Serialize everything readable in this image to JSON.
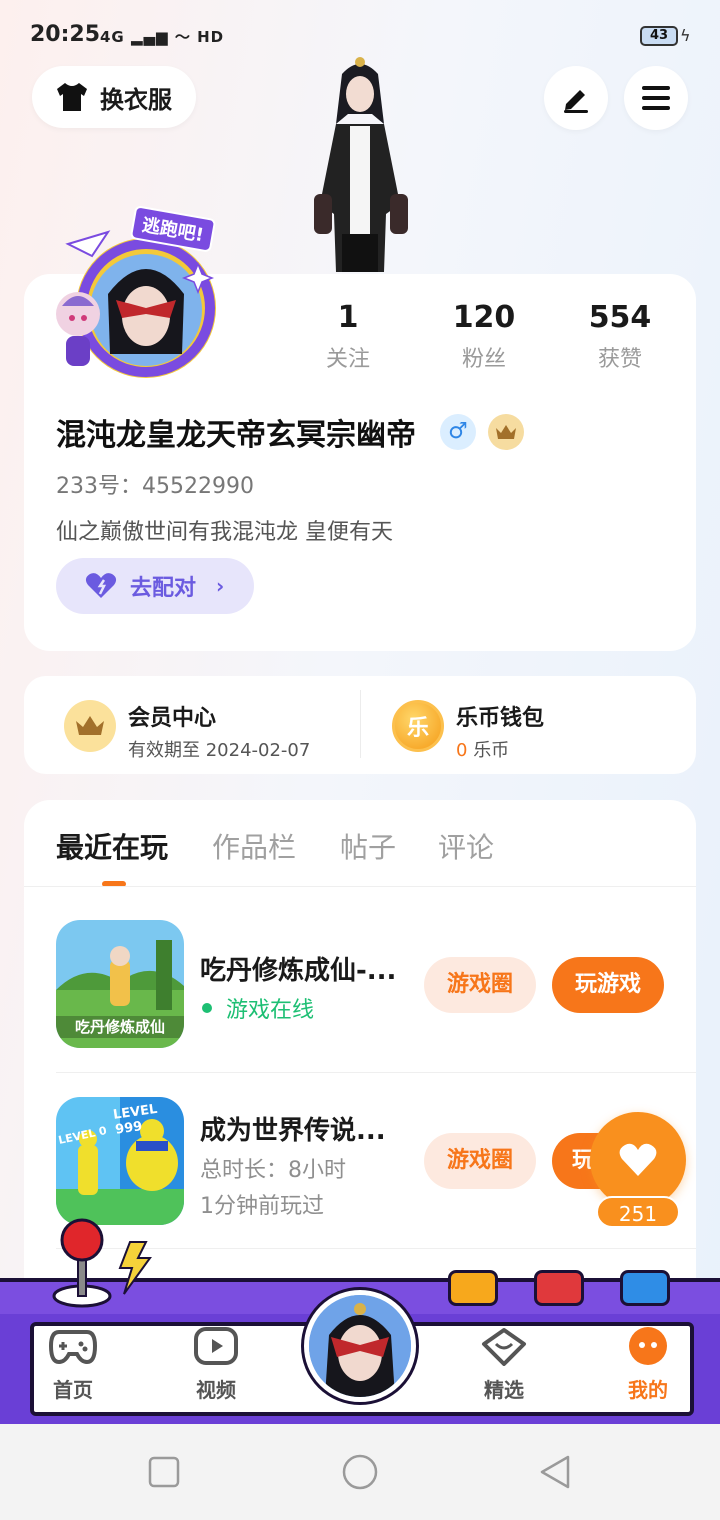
{
  "status_bar": {
    "time": "20:25",
    "signal": "4G",
    "network": "HD",
    "battery": "43"
  },
  "header": {
    "outfit_label": "换衣服",
    "edit_icon": "pen-icon",
    "menu_icon": "hamburger-menu-icon"
  },
  "profile": {
    "avatar_badge_text": "逃跑吧!",
    "username": "混沌龙皇龙天帝玄冥宗幽帝",
    "gender_symbol": "♂",
    "id_label": "233号：",
    "id_value": "45522990",
    "bio": "仙之巅傲世间有我混沌龙 皇便有天",
    "match_label": "去配对",
    "stats": [
      {
        "value": "1",
        "label": "关注"
      },
      {
        "value": "120",
        "label": "粉丝"
      },
      {
        "value": "554",
        "label": "获赞"
      }
    ]
  },
  "membership": {
    "vip_title": "会员中心",
    "vip_sub": "有效期至 2024-02-07",
    "wallet_title": "乐币钱包",
    "wallet_amount": "0",
    "wallet_unit": "乐币",
    "coin_glyph": "乐"
  },
  "tabs": [
    {
      "label": "最近在玩",
      "active": true
    },
    {
      "label": "作品栏",
      "active": false
    },
    {
      "label": "帖子",
      "active": false
    },
    {
      "label": "评论",
      "active": false
    }
  ],
  "games": [
    {
      "title": "吃丹修炼成仙-...",
      "thumb_text": "吃丹修炼成仙",
      "status": "游戏在线",
      "circle_label": "游戏圈",
      "play_label": "玩游戏"
    },
    {
      "title": "成为世界传说...",
      "thumb_level_left": "LEVEL 0",
      "thumb_level_right": "LEVEL 999",
      "duration": "总时长：8小时",
      "last_played": "1分钟前玩过",
      "circle_label": "游戏圈",
      "play_label": "玩"
    }
  ],
  "like_float": {
    "count": "251"
  },
  "bottom_nav": [
    {
      "label": "首页",
      "icon": "gamepad-icon"
    },
    {
      "label": "视频",
      "icon": "play-video-icon"
    },
    {
      "label": "精选",
      "icon": "heart-chat-icon"
    },
    {
      "label": "我的",
      "icon": "profile-face-icon",
      "active": true
    }
  ],
  "colors": {
    "accent": "#f7761a",
    "online": "#1dbf73",
    "purple": "#6a3fd6"
  }
}
